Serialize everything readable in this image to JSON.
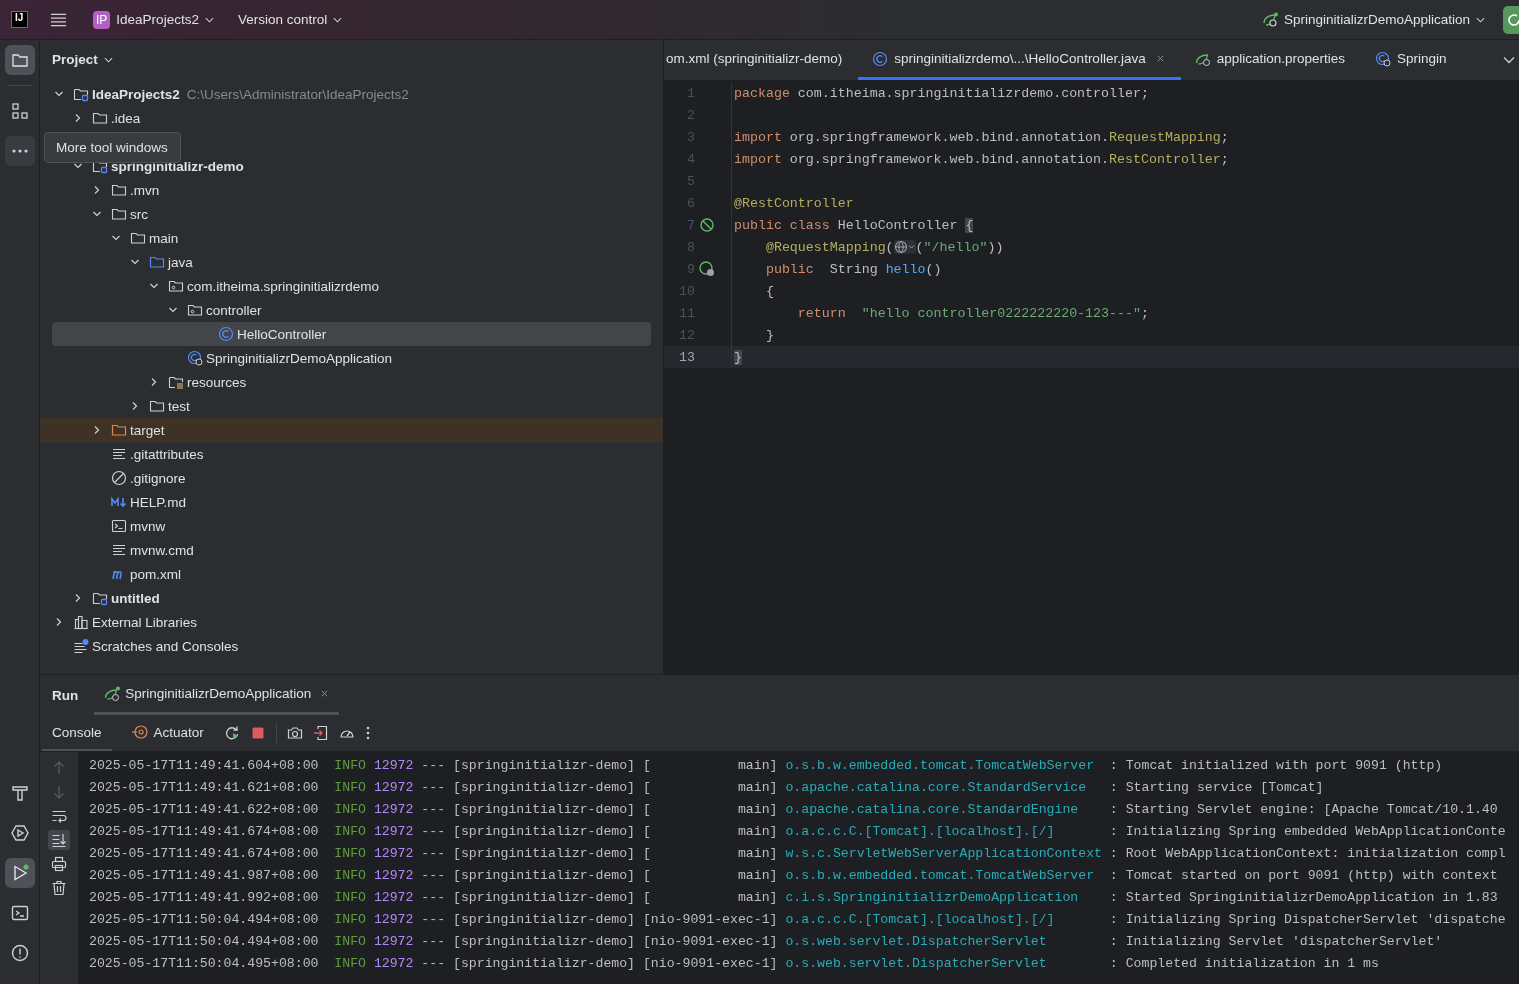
{
  "title_bar": {
    "logo": "IJ",
    "project_badge": "IP",
    "project": "IdeaProjects2",
    "vcs": "Version control",
    "run_config": "SpringinitializrDemoApplication"
  },
  "tool_strip": {
    "top": [
      {
        "kind": "project",
        "selected": true,
        "hovered": false
      },
      {
        "kind": "structure",
        "selected": false,
        "hovered": false
      },
      {
        "kind": "more",
        "selected": false,
        "hovered": true
      }
    ],
    "bottom": [
      {
        "kind": "build",
        "selected": false,
        "running": false
      },
      {
        "kind": "services",
        "selected": false,
        "running": false
      },
      {
        "kind": "run",
        "selected": true,
        "running": true
      },
      {
        "kind": "terminal",
        "selected": false,
        "running": false
      },
      {
        "kind": "problems",
        "selected": false,
        "running": false
      }
    ]
  },
  "tooltip": "More tool windows",
  "project": {
    "title": "Project",
    "tree": [
      {
        "label": "IdeaProjects2",
        "hint": "C:\\Users\\Administrator\\IdeaProjects2",
        "kind": "module",
        "expanded": true,
        "selected": false,
        "children": [
          {
            "label": ".idea",
            "kind": "folder",
            "expanded": false,
            "selected": false
          },
          {
            "kind": "covered"
          },
          {
            "label": "springinitializr-demo",
            "kind": "module",
            "expanded": true,
            "selected": false,
            "children": [
              {
                "label": ".mvn",
                "kind": "folder",
                "expanded": false,
                "selected": false
              },
              {
                "label": "src",
                "kind": "folder",
                "expanded": true,
                "selected": false,
                "children": [
                  {
                    "label": "main",
                    "kind": "folder",
                    "expanded": true,
                    "selected": false,
                    "children": [
                      {
                        "label": "java",
                        "kind": "source-folder",
                        "expanded": true,
                        "selected": false,
                        "children": [
                          {
                            "label": "com.itheima.springinitializrdemo",
                            "kind": "package",
                            "expanded": true,
                            "selected": false,
                            "children": [
                              {
                                "label": "controller",
                                "kind": "package",
                                "expanded": true,
                                "selected": false,
                                "children": [
                                  {
                                    "label": "HelloController",
                                    "kind": "class",
                                    "selected": true
                                  }
                                ]
                              },
                              {
                                "label": "SpringinitializrDemoApplication",
                                "kind": "spring-class",
                                "selected": false
                              }
                            ]
                          },
                          {
                            "label": "resources",
                            "kind": "resources-folder",
                            "expanded": false,
                            "selected": false
                          }
                        ]
                      },
                      {
                        "label": "test",
                        "kind": "folder",
                        "expanded": false,
                        "selected": false
                      }
                    ]
                  }
                ]
              },
              {
                "label": "target",
                "kind": "excluded-folder",
                "expanded": false,
                "selected": false
              },
              {
                "label": ".gitattributes",
                "kind": "text-file",
                "selected": false
              },
              {
                "label": ".gitignore",
                "kind": "ignore-file",
                "selected": false
              },
              {
                "label": "HELP.md",
                "kind": "markdown",
                "selected": false
              },
              {
                "label": "mvnw",
                "kind": "shell",
                "selected": false
              },
              {
                "label": "mvnw.cmd",
                "kind": "text-file",
                "selected": false
              },
              {
                "label": "pom.xml",
                "kind": "maven",
                "selected": false
              }
            ]
          },
          {
            "label": "untitled",
            "kind": "module",
            "expanded": false,
            "selected": false
          }
        ]
      },
      {
        "label": "External Libraries",
        "kind": "libraries",
        "expanded": false,
        "selected": false
      },
      {
        "label": "Scratches and Consoles",
        "kind": "scratches",
        "selected": false
      }
    ]
  },
  "editor": {
    "tabs": [
      {
        "label": "om.xml (springinitializr-demo)",
        "kind": "none",
        "selected": false,
        "closable": false
      },
      {
        "label": "springinitializrdemo\\...\\HelloController.java",
        "kind": "class",
        "selected": true,
        "closable": true
      },
      {
        "label": "application.properties",
        "kind": "spring-props",
        "selected": false,
        "closable": false
      },
      {
        "label": "Springin",
        "kind": "spring-class",
        "selected": false,
        "closable": false
      }
    ],
    "lines": [
      {
        "number": "1",
        "kind": "plain",
        "current": false,
        "tokens": [
          {
            "kind": "keyword",
            "text": "package"
          },
          {
            "kind": "plain",
            "text": " com.itheima.springinitializrdemo.controller;"
          }
        ]
      },
      {
        "number": "2",
        "kind": "plain",
        "current": false
      },
      {
        "number": "3",
        "kind": "plain",
        "current": false,
        "tokens": [
          {
            "kind": "keyword",
            "text": "import"
          },
          {
            "kind": "plain",
            "text": " org.springframework.web.bind.annotation."
          },
          {
            "kind": "annotation",
            "text": "RequestMapping"
          },
          {
            "kind": "plain",
            "text": ";"
          }
        ]
      },
      {
        "number": "4",
        "kind": "plain",
        "current": false,
        "tokens": [
          {
            "kind": "keyword",
            "text": "import"
          },
          {
            "kind": "plain",
            "text": " org.springframework.web.bind.annotation."
          },
          {
            "kind": "annotation",
            "text": "RestController"
          },
          {
            "kind": "plain",
            "text": ";"
          }
        ]
      },
      {
        "number": "5",
        "kind": "plain",
        "current": false
      },
      {
        "number": "6",
        "kind": "plain",
        "current": false,
        "tokens": [
          {
            "kind": "annotation",
            "text": "@RestController"
          }
        ]
      },
      {
        "number": "7",
        "kind": "bean",
        "current": false,
        "tokens": [
          {
            "kind": "keyword",
            "text": "public class"
          },
          {
            "kind": "plain",
            "text": " HelloController "
          },
          {
            "kind": "brace-match",
            "text": "{"
          }
        ]
      },
      {
        "number": "8",
        "kind": "plain",
        "current": false,
        "tokens": [
          {
            "kind": "annotation",
            "text": "    @RequestMapping"
          },
          {
            "kind": "plain",
            "text": "("
          },
          {
            "kind": "inlay"
          },
          {
            "kind": "plain",
            "text": "("
          },
          {
            "kind": "string",
            "text": "\"/hello\""
          },
          {
            "kind": "plain",
            "text": "))"
          }
        ]
      },
      {
        "number": "9",
        "kind": "endpoint",
        "current": false,
        "tokens": [
          {
            "kind": "keyword",
            "text": "    public"
          },
          {
            "kind": "plain",
            "text": "  String "
          },
          {
            "kind": "method",
            "text": "hello"
          },
          {
            "kind": "plain",
            "text": "()"
          }
        ]
      },
      {
        "number": "10",
        "kind": "plain",
        "current": false,
        "tokens": [
          {
            "kind": "plain",
            "text": "    {"
          }
        ]
      },
      {
        "number": "11",
        "kind": "plain",
        "current": false,
        "tokens": [
          {
            "kind": "keyword",
            "text": "        return"
          },
          {
            "kind": "string",
            "text": "  \"hello controller0222222220-123---\""
          },
          {
            "kind": "plain",
            "text": ";"
          }
        ]
      },
      {
        "number": "12",
        "kind": "plain",
        "current": false,
        "tokens": [
          {
            "kind": "plain",
            "text": "    }"
          }
        ]
      },
      {
        "number": "13",
        "kind": "plain",
        "current": true,
        "tokens": [
          {
            "kind": "brace-match",
            "text": "}"
          }
        ]
      }
    ]
  },
  "run_panel": {
    "title": "Run",
    "tabs": [
      {
        "label": "SpringinitializrDemoApplication",
        "selected": true,
        "running": true
      }
    ],
    "console_tabs": [
      {
        "label": "Console",
        "kind": "console",
        "selected": true
      },
      {
        "label": "Actuator",
        "kind": "actuator",
        "selected": false
      }
    ],
    "side_tools": [
      {
        "kind": "up",
        "selected": false,
        "disabled": true
      },
      {
        "kind": "down",
        "selected": false,
        "disabled": true
      },
      {
        "kind": "wrap",
        "selected": false,
        "disabled": false
      },
      {
        "kind": "scroll-end",
        "selected": true,
        "disabled": false
      },
      {
        "kind": "print",
        "selected": false,
        "disabled": false
      },
      {
        "kind": "clear",
        "selected": false,
        "disabled": false
      }
    ],
    "log": [
      {
        "timestamp": "2025-05-17T11:49:41.604+08:00",
        "level": "INFO",
        "pid": "12972",
        "separator": "---",
        "app": "[springinitializr-demo]",
        "thread": "[           main]",
        "logger": "o.s.b.w.embedded.tomcat.TomcatWebServer",
        "message": ": Tomcat initialized with port 9091 (http)"
      },
      {
        "timestamp": "2025-05-17T11:49:41.621+08:00",
        "level": "INFO",
        "pid": "12972",
        "separator": "---",
        "app": "[springinitializr-demo]",
        "thread": "[           main]",
        "logger": "o.apache.catalina.core.StandardService",
        "message": ": Starting service [Tomcat]"
      },
      {
        "timestamp": "2025-05-17T11:49:41.622+08:00",
        "level": "INFO",
        "pid": "12972",
        "separator": "---",
        "app": "[springinitializr-demo]",
        "thread": "[           main]",
        "logger": "o.apache.catalina.core.StandardEngine",
        "message": ": Starting Servlet engine: [Apache Tomcat/10.1.40"
      },
      {
        "timestamp": "2025-05-17T11:49:41.674+08:00",
        "level": "INFO",
        "pid": "12972",
        "separator": "---",
        "app": "[springinitializr-demo]",
        "thread": "[           main]",
        "logger": "o.a.c.c.C.[Tomcat].[localhost].[/]",
        "message": ": Initializing Spring embedded WebApplicationConte"
      },
      {
        "timestamp": "2025-05-17T11:49:41.674+08:00",
        "level": "INFO",
        "pid": "12972",
        "separator": "---",
        "app": "[springinitializr-demo]",
        "thread": "[           main]",
        "logger": "w.s.c.ServletWebServerApplicationContext",
        "message": ": Root WebApplicationContext: initialization compl"
      },
      {
        "timestamp": "2025-05-17T11:49:41.987+08:00",
        "level": "INFO",
        "pid": "12972",
        "separator": "---",
        "app": "[springinitializr-demo]",
        "thread": "[           main]",
        "logger": "o.s.b.w.embedded.tomcat.TomcatWebServer",
        "message": ": Tomcat started on port 9091 (http) with context"
      },
      {
        "timestamp": "2025-05-17T11:49:41.992+08:00",
        "level": "INFO",
        "pid": "12972",
        "separator": "---",
        "app": "[springinitializr-demo]",
        "thread": "[           main]",
        "logger": "c.i.s.SpringinitializrDemoApplication",
        "message": ": Started SpringinitializrDemoApplication in 1.83"
      },
      {
        "timestamp": "2025-05-17T11:50:04.494+08:00",
        "level": "INFO",
        "pid": "12972",
        "separator": "---",
        "app": "[springinitializr-demo]",
        "thread": "[nio-9091-exec-1]",
        "logger": "o.a.c.c.C.[Tomcat].[localhost].[/]",
        "message": ": Initializing Spring DispatcherServlet 'dispatche"
      },
      {
        "timestamp": "2025-05-17T11:50:04.494+08:00",
        "level": "INFO",
        "pid": "12972",
        "separator": "---",
        "app": "[springinitializr-demo]",
        "thread": "[nio-9091-exec-1]",
        "logger": "o.s.web.servlet.DispatcherServlet",
        "message": ": Initializing Servlet 'dispatcherServlet'"
      },
      {
        "timestamp": "2025-05-17T11:50:04.495+08:00",
        "level": "INFO",
        "pid": "12972",
        "separator": "---",
        "app": "[springinitializr-demo]",
        "thread": "[nio-9091-exec-1]",
        "logger": "o.s.web.servlet.DispatcherServlet",
        "message": ": Completed initialization in 1 ms"
      }
    ]
  }
}
